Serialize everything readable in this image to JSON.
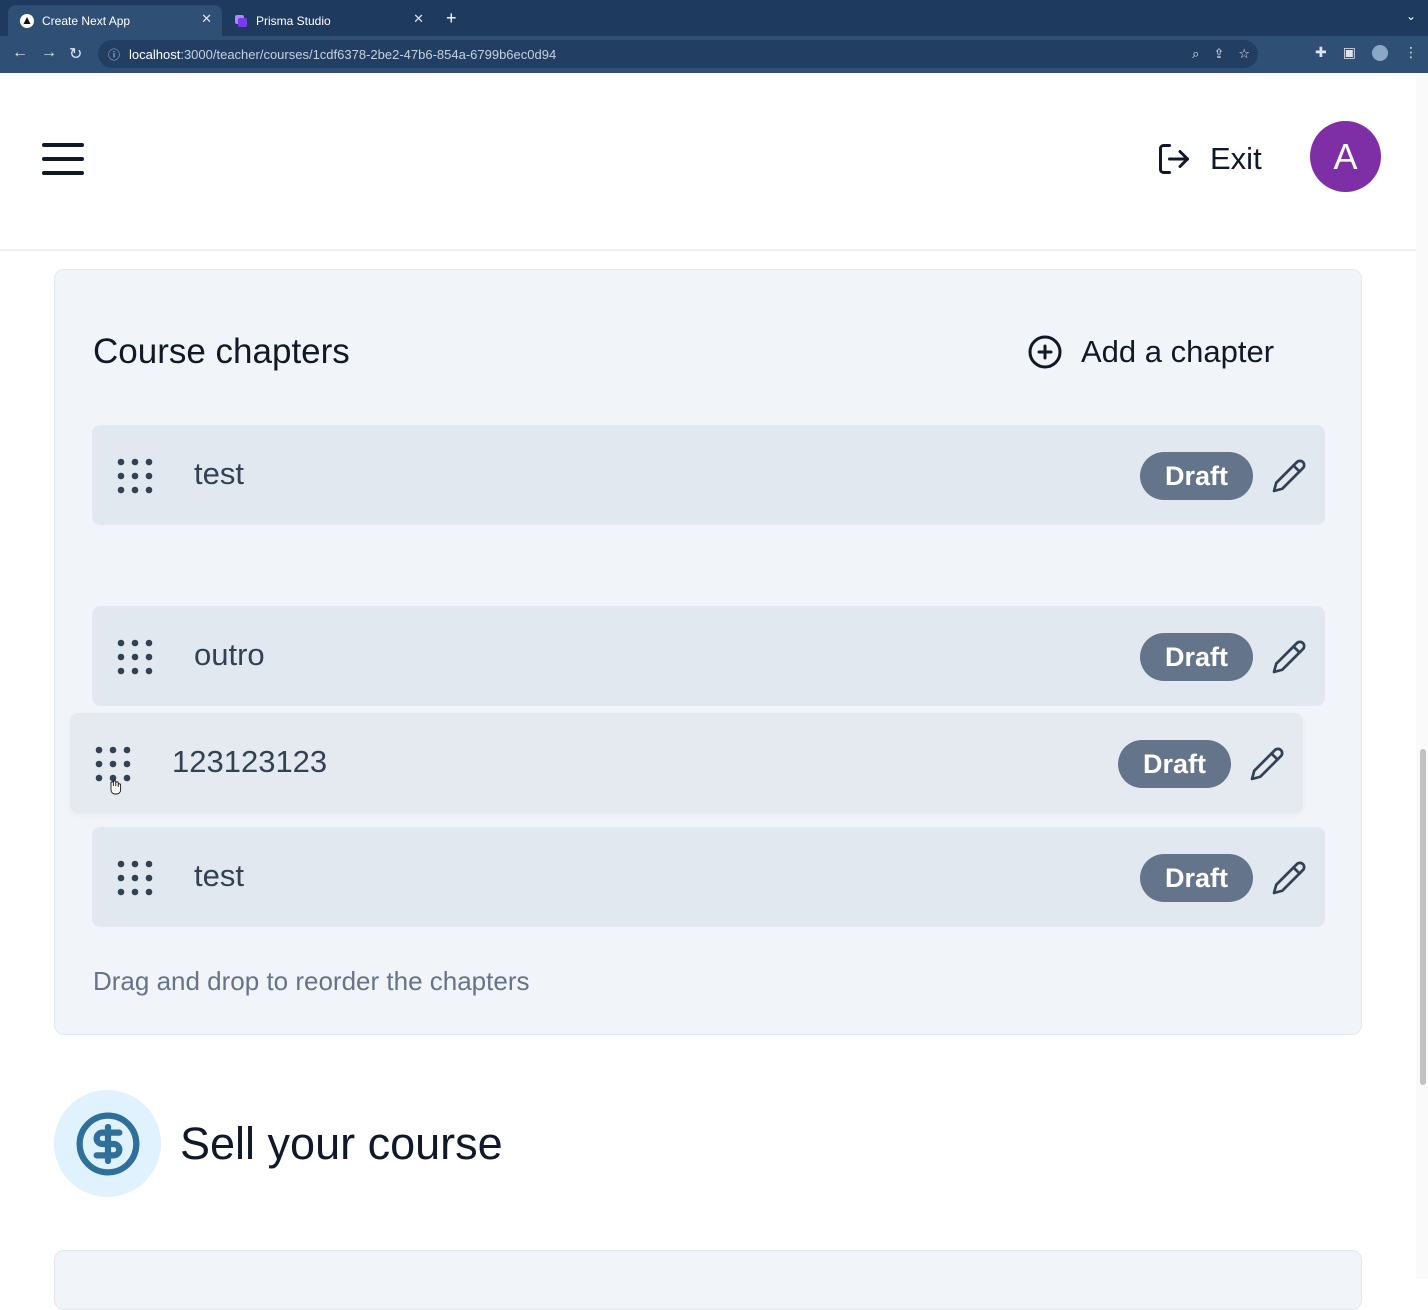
{
  "browser": {
    "tabs": [
      {
        "title": "Create Next App",
        "active": true
      },
      {
        "title": "Prisma Studio",
        "active": false
      }
    ],
    "url_host": "localhost",
    "url_path": ":3000/teacher/courses/1cdf6378-2be2-47b6-854a-6799b6ec0d94"
  },
  "header": {
    "exit_label": "Exit",
    "avatar_initial": "A"
  },
  "chapters": {
    "title": "Course chapters",
    "add_label": "Add a chapter",
    "items": [
      {
        "title": "test",
        "status": "Draft"
      },
      {
        "title": "outro",
        "status": "Draft"
      },
      {
        "title": "123123123",
        "status": "Draft",
        "dragging": true
      },
      {
        "title": "test",
        "status": "Draft"
      }
    ],
    "hint": "Drag and drop to reorder the chapters"
  },
  "sell": {
    "title": "Sell your course"
  },
  "colors": {
    "browser_chrome": "#1f3a5f",
    "avatar": "#7e2fa5",
    "badge": "#64748b",
    "card_bg": "#f1f5f9",
    "row_bg": "#e2e8f0",
    "accent_icon": "#2f6f99"
  }
}
